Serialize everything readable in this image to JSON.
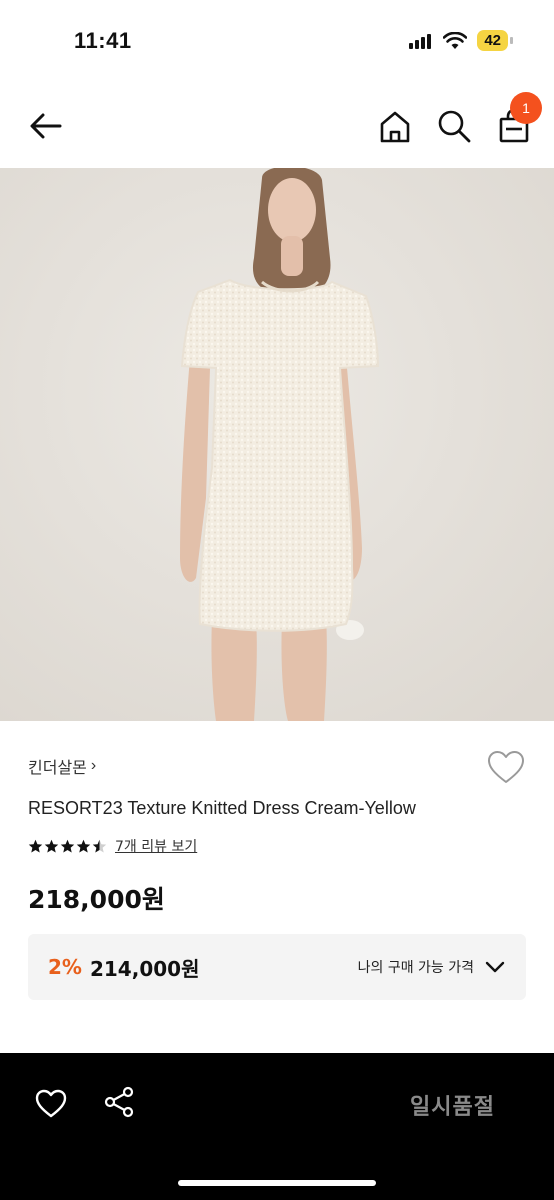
{
  "status_bar": {
    "time": "11:41",
    "battery": "42",
    "icons": [
      "signal-icon",
      "wifi-icon",
      "battery-icon"
    ]
  },
  "nav": {
    "cart_count": "1",
    "icons": [
      "back-arrow-icon",
      "home-icon",
      "search-icon",
      "shopping-bag-icon"
    ]
  },
  "product": {
    "brand": "킨더살몬",
    "brand_chevron": "›",
    "title": "RESORT23 Texture Knitted Dress Cream-Yellow",
    "rating": 4.5,
    "review_link": "7개 리뷰 보기",
    "price": "218,000원"
  },
  "discount": {
    "rate": "2%",
    "price": "214,000원",
    "label": "나의 구매 가능 가격"
  },
  "bottom_bar": {
    "status": "일시품절",
    "icons": [
      "heart-icon",
      "share-icon"
    ]
  },
  "colors": {
    "accent_orange": "#f4511e",
    "discount_orange": "#e8601c",
    "bottom_bar": "#000000",
    "soldout_text": "#8a8a8a"
  }
}
